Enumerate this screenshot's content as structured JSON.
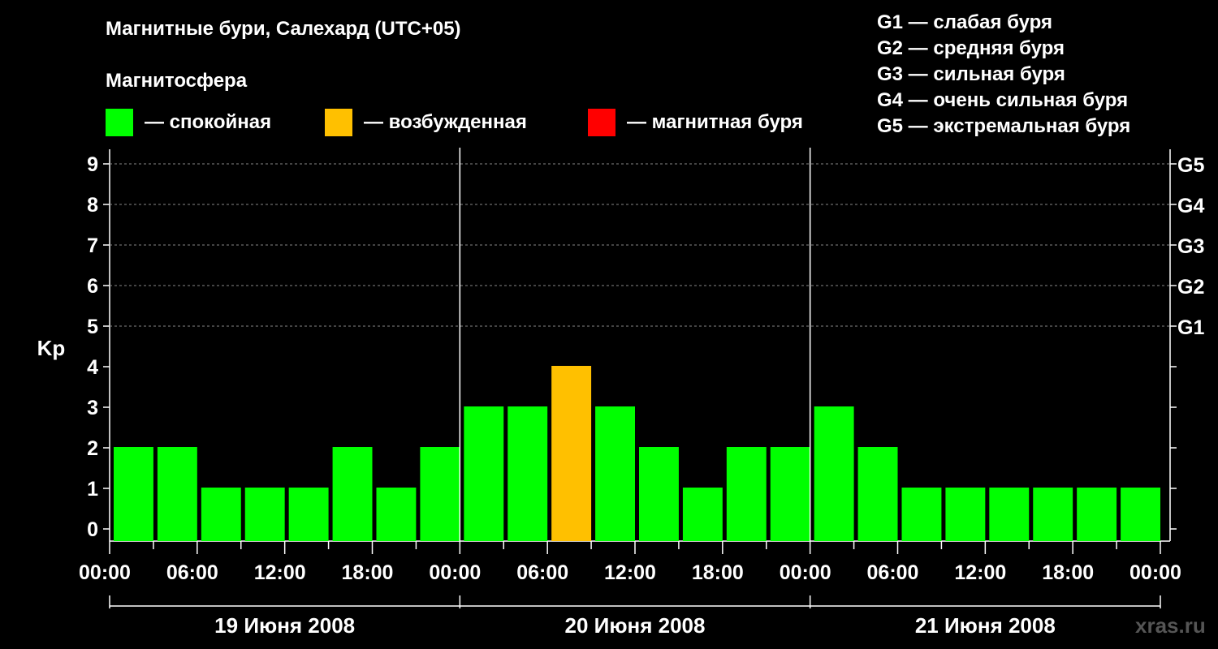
{
  "header": {
    "title": "Магнитные бури, Салехард (UTC+05)",
    "subtitle": "Магнитосфера"
  },
  "legend": [
    {
      "label": "— спокойная",
      "color": "#00ff00"
    },
    {
      "label": "— возбужденная",
      "color": "#ffc000"
    },
    {
      "label": "— магнитная буря",
      "color": "#ff0000"
    }
  ],
  "storm_levels": [
    "G1 — слабая буря",
    "G2 — средняя буря",
    "G3 — сильная буря",
    "G4 — очень сильная буря",
    "G5 — экстремальная буря"
  ],
  "watermark": "xras.ru",
  "chart_data": {
    "type": "bar",
    "ylabel": "Kp",
    "ylim": [
      0,
      9
    ],
    "yticks": [
      "0",
      "1",
      "2",
      "3",
      "4",
      "5",
      "6",
      "7",
      "8",
      "9"
    ],
    "right_ticks": [
      "G1",
      "G2",
      "G3",
      "G4",
      "G5"
    ],
    "xticks": [
      "00:00",
      "06:00",
      "12:00",
      "18:00",
      "00:00",
      "06:00",
      "12:00",
      "18:00",
      "00:00",
      "06:00",
      "12:00",
      "18:00",
      "00:00"
    ],
    "days": [
      "19 Июня 2008",
      "20 Июня 2008",
      "21 Июня 2008"
    ],
    "values": [
      2,
      2,
      1,
      1,
      1,
      2,
      1,
      2,
      3,
      3,
      4,
      3,
      2,
      1,
      2,
      2,
      3,
      2,
      1,
      1,
      1,
      1,
      1,
      1
    ],
    "colors": {
      "quiet": "#00ff00",
      "active": "#ffc000",
      "storm": "#ff0000"
    }
  }
}
